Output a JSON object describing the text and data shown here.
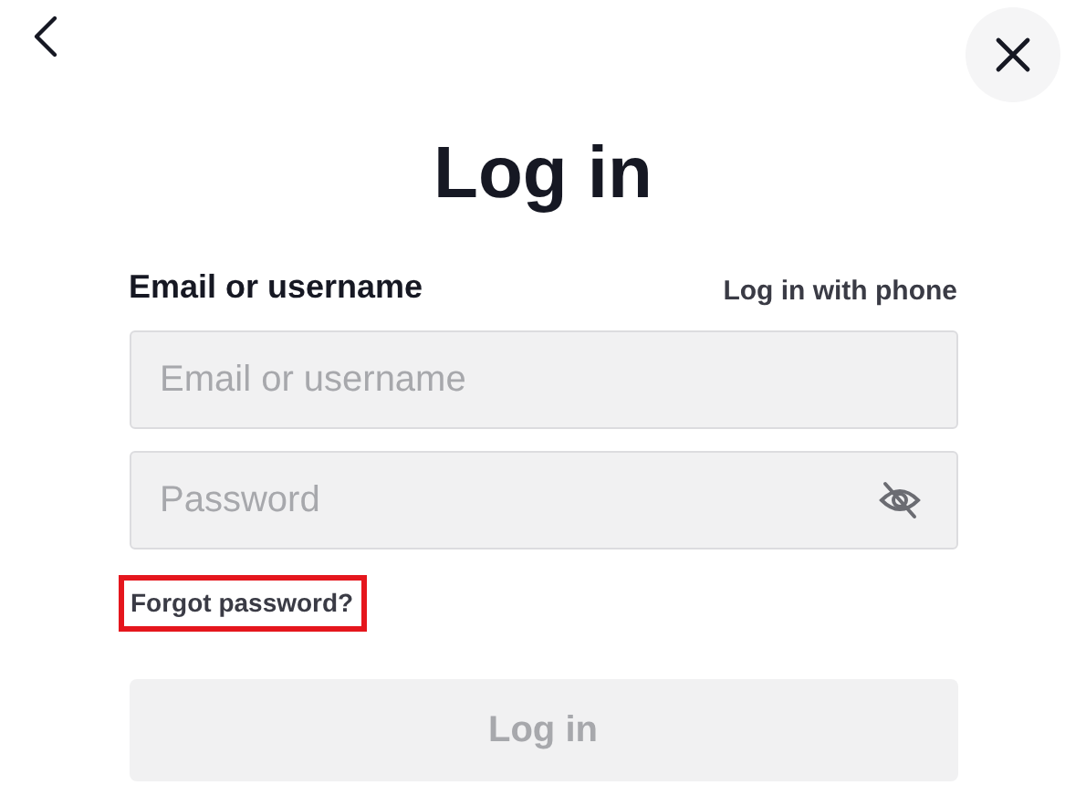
{
  "title": "Log in",
  "email": {
    "label": "Email or username",
    "alt_link": "Log in with phone",
    "placeholder": "Email or username"
  },
  "password": {
    "placeholder": "Password",
    "visible": false
  },
  "forgot_link": {
    "label": "Forgot password?",
    "highlighted": true
  },
  "submit": {
    "label": "Log in",
    "disabled": true
  }
}
